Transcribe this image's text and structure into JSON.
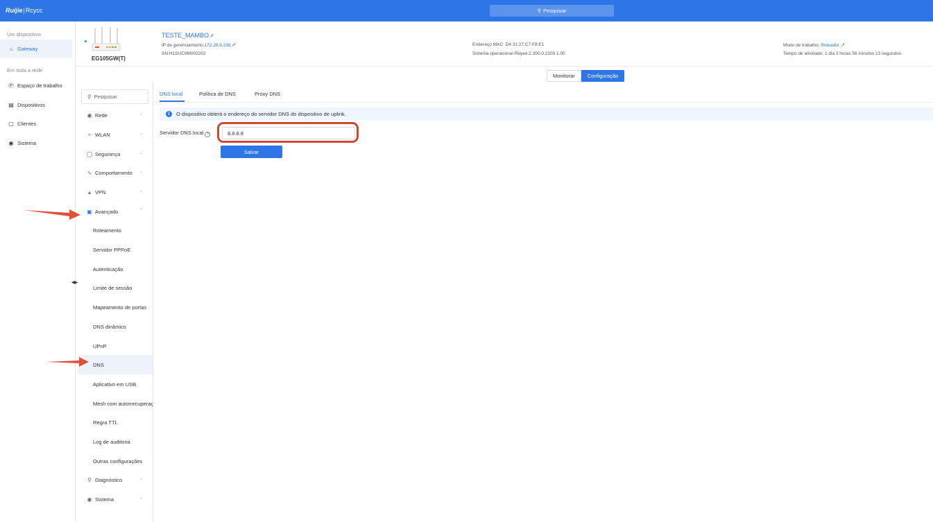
{
  "topbar": {
    "logo_brand": "Ruijie",
    "logo_sep": "|",
    "logo_sub": "Rcycc",
    "search_label": "Pesquisar"
  },
  "leftnav": {
    "section_one": "Um dispositivo",
    "gateway": "Gateway",
    "section_network": "Em toda a rede",
    "items": [
      {
        "label": "Espaço de trabalho"
      },
      {
        "label": "Dispositivos"
      },
      {
        "label": "Clientes"
      },
      {
        "label": "Sistema"
      }
    ]
  },
  "device": {
    "model": "EG105GW(T)",
    "name": "TESTE_MAMBO",
    "mgmt_ip_label": "IP de gerenciamento:",
    "mgmt_ip": "172.26.9.236",
    "sn": "SN:H1SUC9M002202",
    "mac": "Endereço MAC: D4:31:27:C7:F8:E1",
    "os": "Sistema operacional Reyee:2.300.0.2109 1.00",
    "work_mode_label": "Modo de trabalho:",
    "work_mode": "Roteador",
    "uptime": "Tempo de atividade: 1 dia 3 horas 56 minutos 13 segundos"
  },
  "view_toggle": {
    "monitor": "Monitorar",
    "config": "Configuração"
  },
  "subnav": {
    "search_placeholder": "Pesquisar",
    "menus": [
      {
        "label": "Rede"
      },
      {
        "label": "WLAN"
      },
      {
        "label": "Segurança"
      },
      {
        "label": "Comportamento"
      },
      {
        "label": "VPN"
      },
      {
        "label": "Avançado"
      }
    ],
    "advanced_items": [
      {
        "label": "Roteamento"
      },
      {
        "label": "Servidor PPPoE"
      },
      {
        "label": "Autenticação"
      },
      {
        "label": "Limite de sessão"
      },
      {
        "label": "Mapeamento de portas"
      },
      {
        "label": "DNS dinâmico"
      },
      {
        "label": "UPnP"
      },
      {
        "label": "DNS"
      },
      {
        "label": "Aplicativo em USB"
      },
      {
        "label": "Mesh com autorrecuperação"
      },
      {
        "label": "Regra TTL"
      },
      {
        "label": "Log de auditoria"
      },
      {
        "label": "Outras configurações"
      }
    ],
    "diagnostics": "Diagnóstico",
    "system": "Sistema"
  },
  "content": {
    "tabs": [
      {
        "label": "DNS local"
      },
      {
        "label": "Política de DNS"
      },
      {
        "label": "Proxy DNS"
      }
    ],
    "info_text": "O dispositivo obterá o endereço do servidor DNS do dispositivo de uplink.",
    "dns_label": "Servidor DNS local",
    "dns_value": "8.8.8.8",
    "save_label": "Salvar"
  },
  "colors": {
    "accent": "#2e75e8",
    "annotation": "#d2472f"
  }
}
